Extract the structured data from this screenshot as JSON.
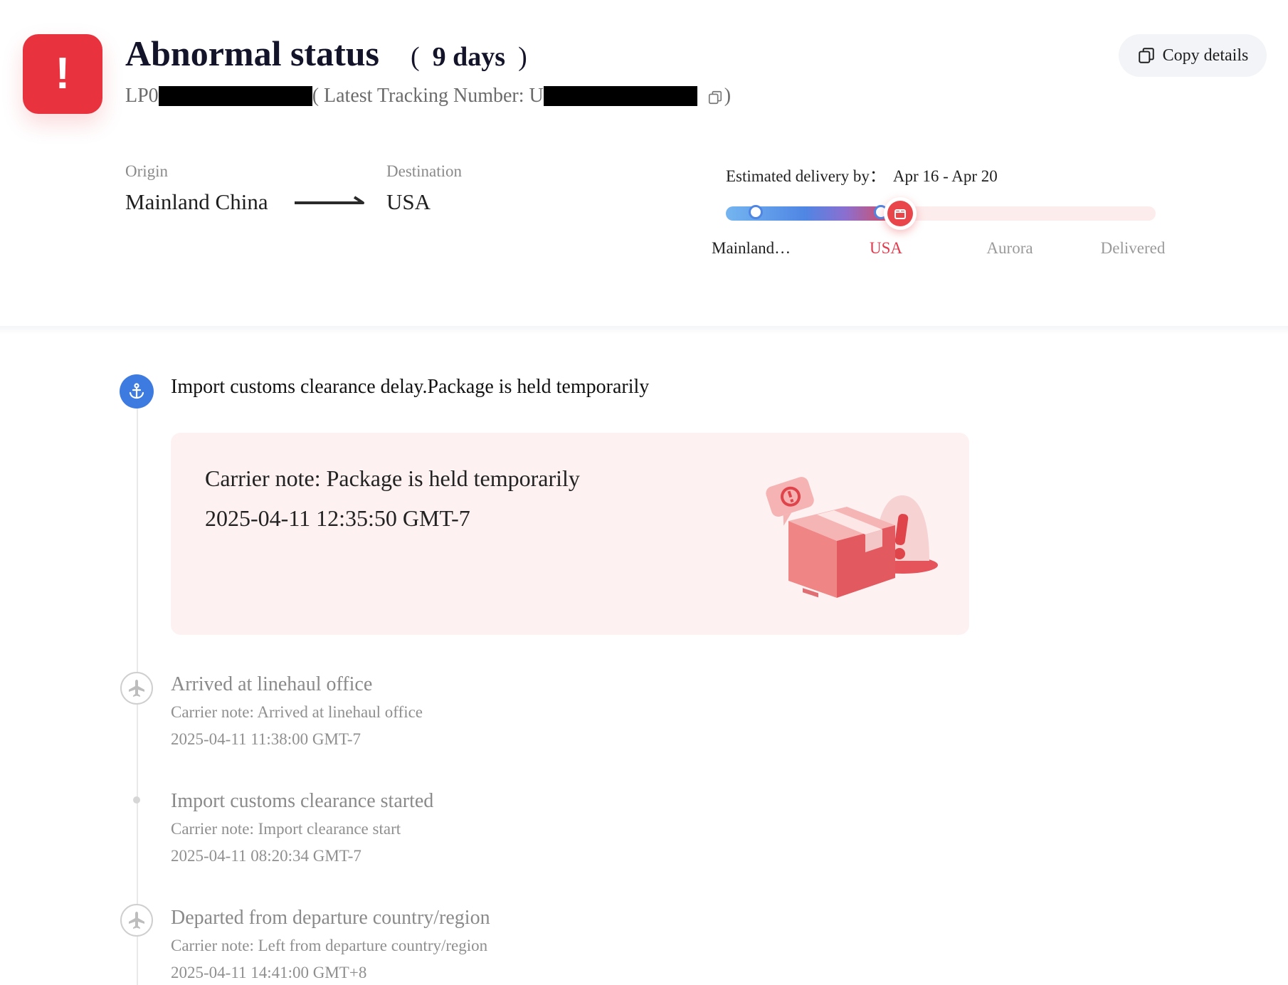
{
  "header": {
    "alert_icon": "exclamation-icon",
    "status_title": "Abnormal status",
    "paren_open": "(",
    "days": "9 days",
    "paren_close": ")",
    "order_prefix": "LP0",
    "latest_label": "( Latest Tracking Number: U",
    "latest_suffix": ")",
    "copy_button": "Copy details",
    "accent_color": "#e8333f"
  },
  "route": {
    "origin_label": "Origin",
    "origin_value": "Mainland China",
    "destination_label": "Destination",
    "destination_value": "USA",
    "eta_label": "Estimated delivery by：",
    "eta_value": "Apr 16 - Apr 20"
  },
  "progress": {
    "stages": [
      "Mainland…",
      "USA",
      "Aurora",
      "Delivered"
    ],
    "current_stage": "USA",
    "current_color": "#e8464b"
  },
  "timeline": {
    "active": {
      "icon": "anchor-icon",
      "title": "Import customs clearance delay.Package is held temporarily",
      "card_note": "Carrier note: Package is held temporarily",
      "card_time": "2025-04-11 12:35:50 GMT-7",
      "illustration": "held-package-illustration"
    },
    "events": [
      {
        "icon": "plane-icon",
        "title": "Arrived at linehaul office",
        "note": "Carrier note: Arrived at linehaul office",
        "time": "2025-04-11 11:38:00 GMT-7"
      },
      {
        "icon": "dot",
        "title": "Import customs clearance started",
        "note": "Carrier note: Import clearance start",
        "time": "2025-04-11 08:20:34 GMT-7"
      },
      {
        "icon": "plane-icon",
        "title": "Departed from departure country/region",
        "note": "Carrier note: Left from departure country/region",
        "time": "2025-04-11 14:41:00 GMT+8"
      }
    ]
  }
}
